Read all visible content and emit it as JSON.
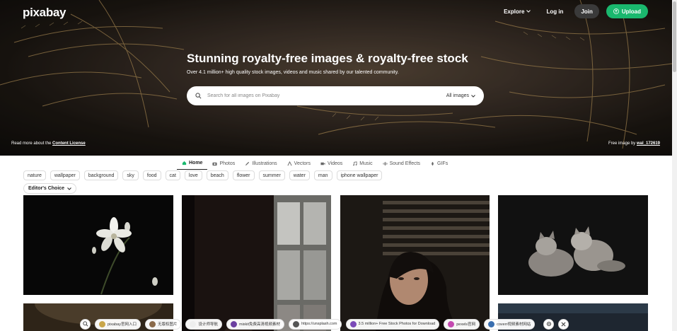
{
  "header": {
    "logo": "pixabay",
    "nav": {
      "explore": "Explore",
      "login": "Log in",
      "join": "Join",
      "upload": "Upload"
    }
  },
  "hero": {
    "title": "Stunning royalty-free images & royalty-free stock",
    "subtitle": "Over 4.1 million+ high quality stock images, videos and music shared by our talented community.",
    "search": {
      "placeholder": "Search for all images on Pixabay",
      "filter": "All images"
    },
    "license_prefix": "Read more about the",
    "license_link": "Content License",
    "credit_prefix": "Free image by",
    "credit_user": "wal_172619"
  },
  "tabs": [
    {
      "label": "Home",
      "icon": "home-icon",
      "active": true
    },
    {
      "label": "Photos",
      "icon": "camera-icon"
    },
    {
      "label": "Illustrations",
      "icon": "brush-icon"
    },
    {
      "label": "Vectors",
      "icon": "vector-icon"
    },
    {
      "label": "Videos",
      "icon": "video-icon"
    },
    {
      "label": "Music",
      "icon": "music-icon"
    },
    {
      "label": "Sound Effects",
      "icon": "waveform-icon"
    },
    {
      "label": "GIFs",
      "icon": "gif-icon"
    }
  ],
  "tags": [
    "nature",
    "wallpaper",
    "background",
    "sky",
    "food",
    "cat",
    "love",
    "beach",
    "flower",
    "summer",
    "water",
    "man",
    "iphone wallpaper"
  ],
  "sort": {
    "label": "Editor's Choice"
  },
  "bottom_bar": {
    "items": [
      {
        "label": "pixabay官网入口",
        "color": "#c9a64a"
      },
      {
        "label": "无版权图片",
        "color": "#8a6a4a"
      },
      {
        "label": "设计师导航",
        "color": "#eeeeee"
      },
      {
        "label": "mixkit免费高清视频素材",
        "color": "#6b3fa0"
      },
      {
        "label": "https://unsplash.com",
        "color": "#555555"
      },
      {
        "label": "3.5 million+ Free Stock Photos for Download",
        "color": "#7b4ab8"
      },
      {
        "label": "pexels官网",
        "color": "#c44ab0"
      },
      {
        "label": "coverr视频素材网站",
        "color": "#3a6fb0"
      }
    ]
  },
  "colors": {
    "accent": "#1ab86e",
    "join_bg": "#3a3a3a"
  }
}
